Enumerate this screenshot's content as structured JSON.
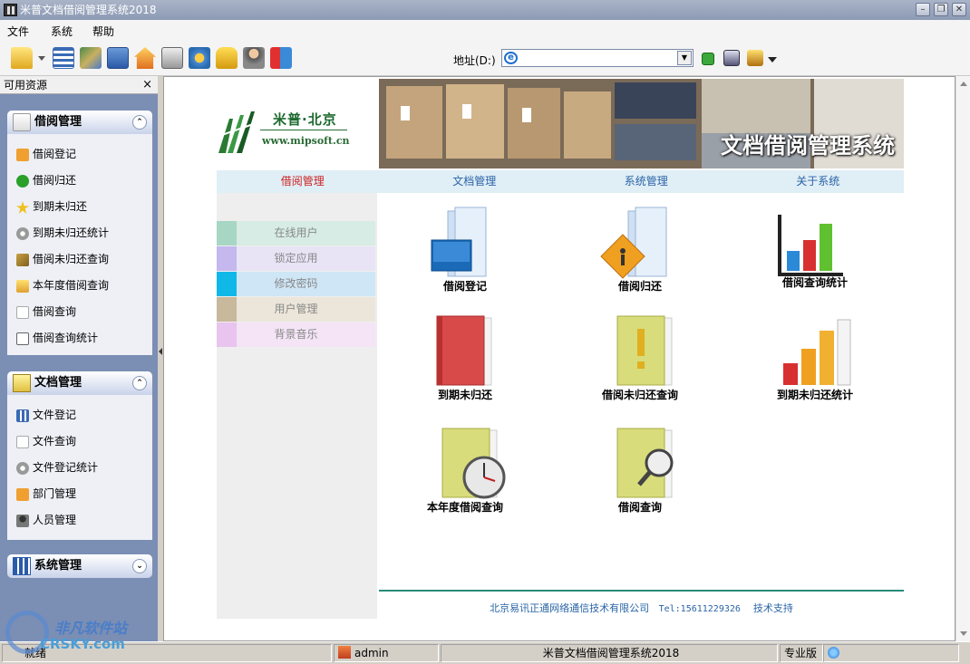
{
  "window": {
    "title": "米普文档借阅管理系统2018"
  },
  "menubar": {
    "items": [
      "文件",
      "系统",
      "帮助"
    ]
  },
  "address": {
    "label": "地址(D:)",
    "value": ""
  },
  "sidebar": {
    "title": "可用资源",
    "close": "×",
    "groups": [
      {
        "title": "借阅管理",
        "items": [
          "借阅登记",
          "借阅归还",
          "到期未归还",
          "到期未归还统计",
          "借阅未归还查询",
          "本年度借阅查询",
          "借阅查询",
          "借阅查询统计"
        ]
      },
      {
        "title": "文档管理",
        "items": [
          "文件登记",
          "文件查询",
          "文件登记统计",
          "部门管理",
          "人员管理"
        ]
      },
      {
        "title": "系统管理",
        "items": []
      }
    ]
  },
  "logo": {
    "cn": "米普·北京",
    "url": "www.mipsoft.cn"
  },
  "banner": {
    "title": "文档借阅管理系统"
  },
  "nav": {
    "items": [
      "借阅管理",
      "文档管理",
      "系统管理",
      "关于系统"
    ],
    "active": 0
  },
  "left_menu": [
    "在线用户",
    "锁定应用",
    "修改密码",
    "用户管理",
    "背景音乐"
  ],
  "tiles": [
    "借阅登记",
    "借阅归还",
    "借阅查询统计",
    "到期未归还",
    "借阅未归还查询",
    "到期未归还统计",
    "本年度借阅查询",
    "借阅查询"
  ],
  "footer": {
    "company": "北京易讯正通网络通信技术有限公司",
    "tel": "Tel:15611229326",
    "support": "技术支持"
  },
  "status": {
    "ready": "就绪",
    "user": "admin",
    "app": "米普文档借阅管理系统2018",
    "edition": "专业版"
  },
  "watermark": {
    "cn": "非凡软件站",
    "en": "CRSKY.com"
  },
  "colors": {
    "nav_active": "#cc2222",
    "nav": "#2a64a6",
    "sidebar_bg": "#7b8eb4",
    "footer_line": "#2a8a7a"
  }
}
